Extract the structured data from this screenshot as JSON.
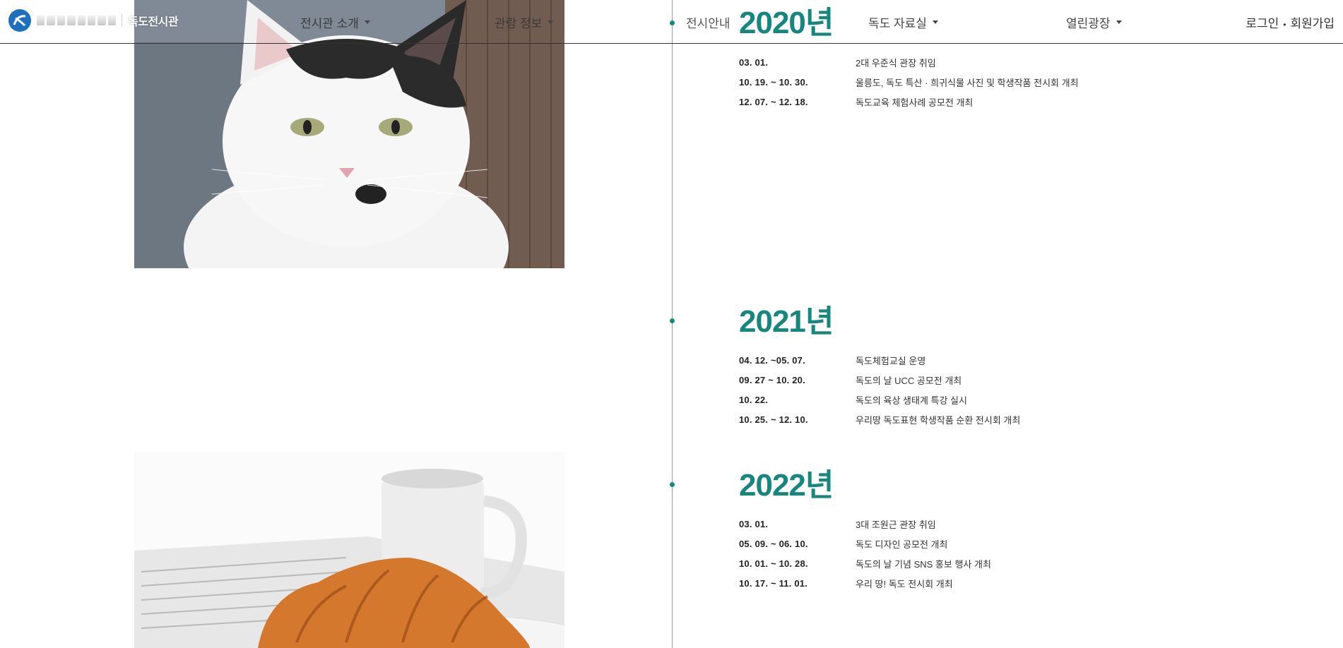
{
  "header": {
    "site_name": "독도전시관",
    "nav": {
      "intro": "전시관 소개",
      "tour": "관람 정보",
      "exhibit": "전시안내",
      "library": "독도 자료실",
      "square": "열린광장"
    },
    "auth": {
      "login": "로그인",
      "separator": "•",
      "signup": "회원가입"
    }
  },
  "timeline": {
    "accent_color": "#17867e",
    "years": [
      {
        "year": "2020년",
        "events": [
          {
            "date": "03. 01.",
            "desc": "2대 우준식 관장 취임"
          },
          {
            "date": "10. 19. ~ 10. 30.",
            "desc": "울릉도, 독도 특산 · 희귀식물 사진 및 학생작품 전시회 개최"
          },
          {
            "date": "12. 07. ~ 12. 18.",
            "desc": "독도교육 체험사례 공모전 개최"
          }
        ]
      },
      {
        "year": "2021년",
        "events": [
          {
            "date": "04. 12. ~05. 07.",
            "desc": "독도체험교실 운영"
          },
          {
            "date": "09. 27 ~ 10. 20.",
            "desc": "독도의 날 UCC 공모전 개최"
          },
          {
            "date": "10. 22.",
            "desc": "독도의 육상 생태계 특강 실시"
          },
          {
            "date": "10. 25. ~ 12. 10.",
            "desc": "우리땅 독도표현 학생작품 순환 전시회 개최"
          }
        ]
      },
      {
        "year": "2022년",
        "events": [
          {
            "date": "03. 01.",
            "desc": "3대 조원근 관장 취임"
          },
          {
            "date": "05. 09. ~ 06. 10.",
            "desc": "독도 디자인 공모전 개최"
          },
          {
            "date": "10. 01. ~ 10. 28.",
            "desc": "독도의 날 기념 SNS 홍보 행사 개최"
          },
          {
            "date": "10. 17. ~ 11. 01.",
            "desc": "우리 땅! 독도 전시회 개최"
          }
        ]
      }
    ]
  },
  "images": {
    "top": "cat-photo",
    "bottom": "croissant-coffee-photo"
  }
}
